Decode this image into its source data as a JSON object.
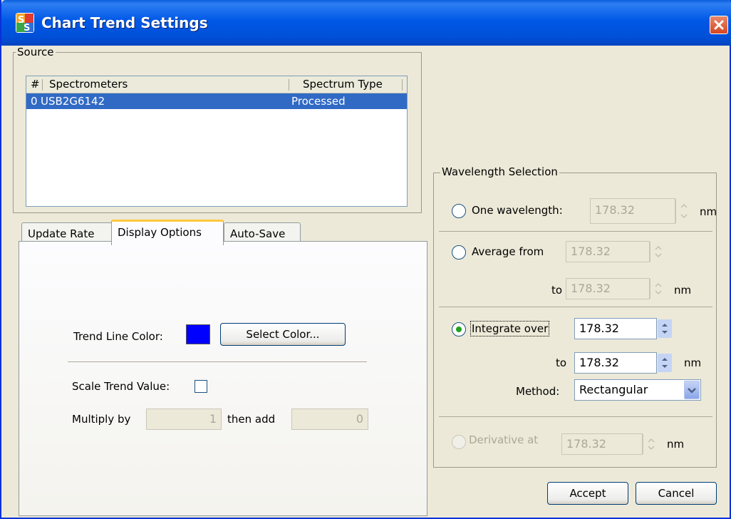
{
  "window": {
    "title": "Chart Trend Settings",
    "app_icon_text": "SS"
  },
  "source": {
    "legend": "Source",
    "columns": [
      "#",
      "Spectrometers",
      "Spectrum Type"
    ],
    "rows": [
      {
        "index": "0",
        "spectrometer": "USB2G6142",
        "type": "Processed"
      }
    ]
  },
  "tabs": {
    "items": [
      "Update Rate",
      "Display Options",
      "Auto-Save"
    ],
    "active": "Display Options"
  },
  "display_options": {
    "trend_line_color_label": "Trend Line Color:",
    "trend_line_color": "#0000ff",
    "select_color_button": "Select Color...",
    "scale_trend_label": "Scale Trend Value:",
    "scale_trend_checked": false,
    "multiply_label": "Multiply by",
    "multiply_value": "1",
    "then_add_label": "then add",
    "add_value": "0"
  },
  "wavelength": {
    "legend": "Wavelength Selection",
    "one": {
      "label": "One wavelength:",
      "value": "178.32",
      "unit": "nm"
    },
    "average": {
      "label": "Average from",
      "from": "178.32",
      "to_label": "to",
      "to": "178.32",
      "unit": "nm"
    },
    "integrate": {
      "label": "Integrate over",
      "from": "178.32",
      "to_label": "to",
      "to": "178.32",
      "unit": "nm",
      "method_label": "Method:",
      "method": "Rectangular",
      "selected": true
    },
    "derivative": {
      "label": "Derivative at",
      "value": "178.32",
      "unit": "nm"
    }
  },
  "buttons": {
    "accept": "Accept",
    "cancel": "Cancel"
  }
}
